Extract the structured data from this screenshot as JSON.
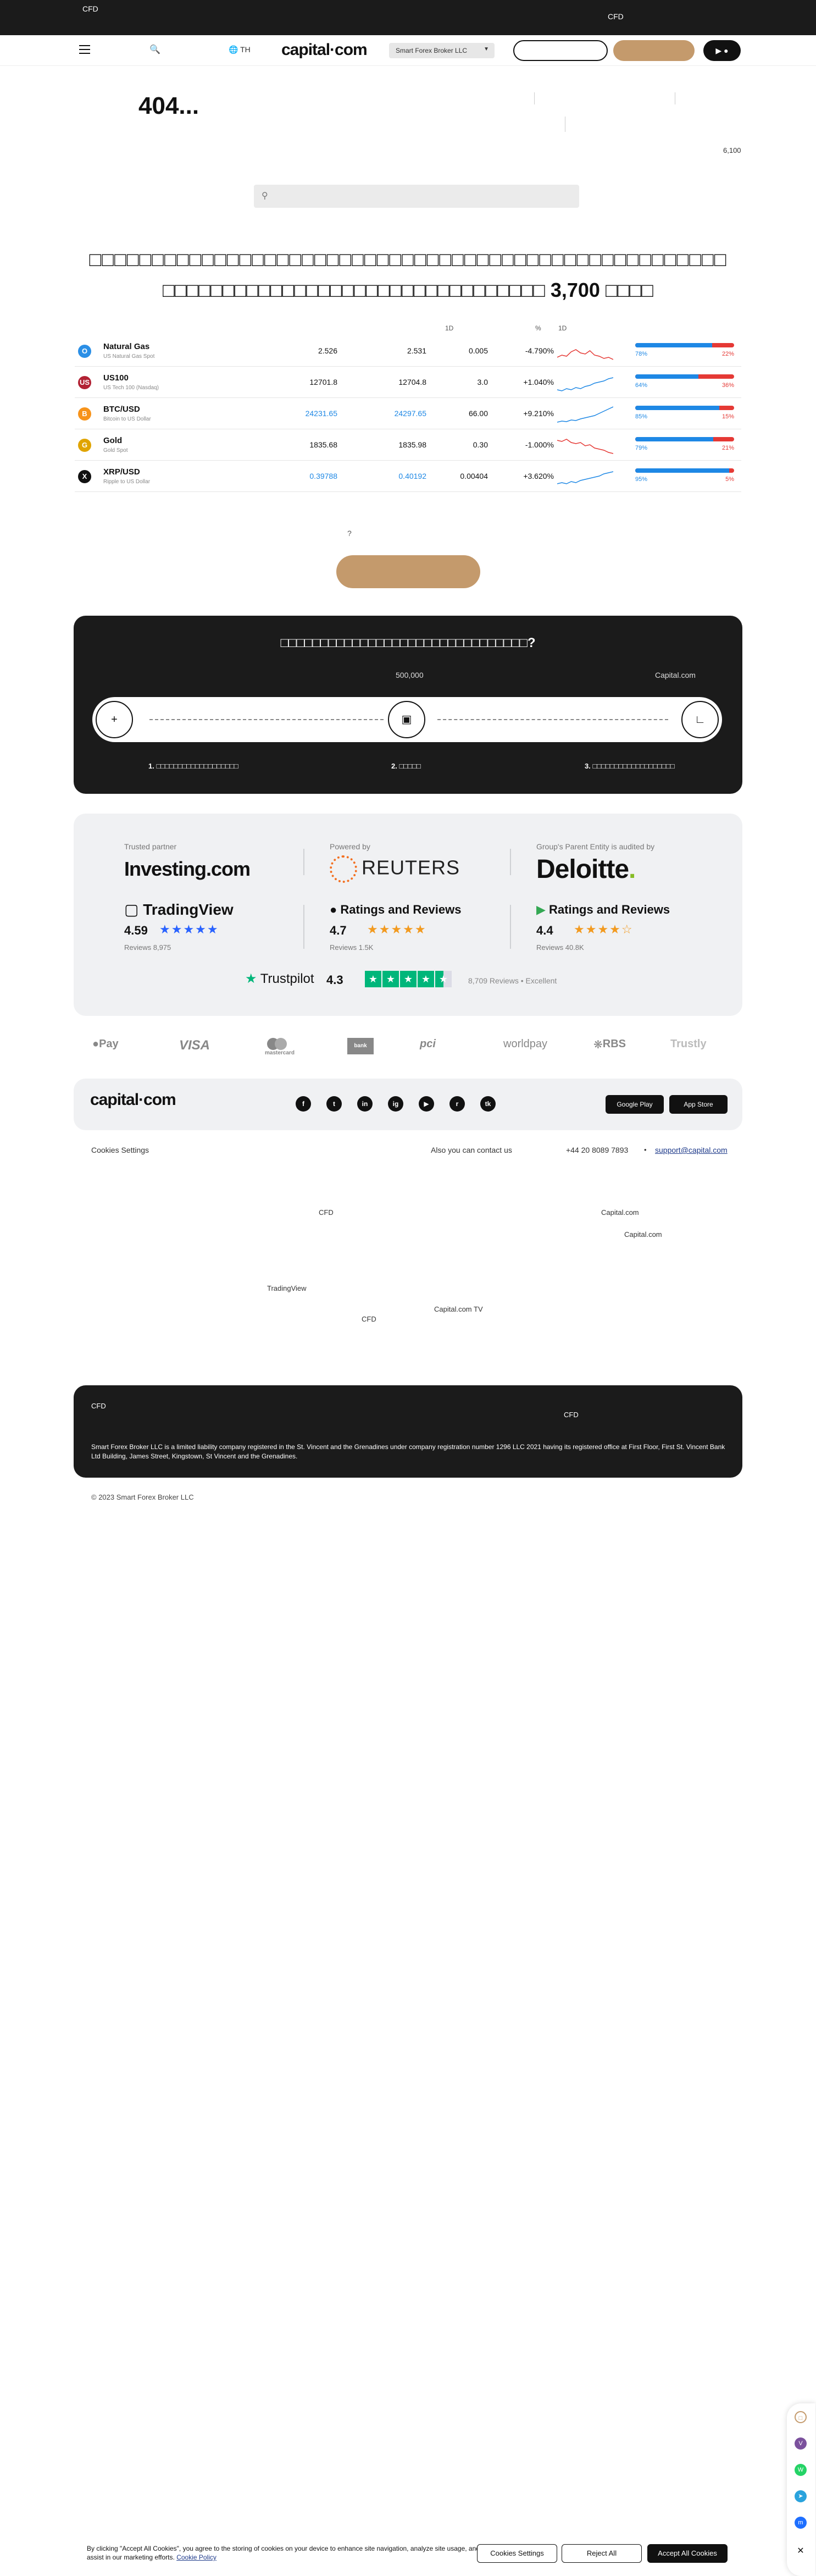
{
  "topbar": {
    "left_label": "CFD",
    "right_label": "CFD"
  },
  "header": {
    "lang": "TH",
    "logo": "capital·com",
    "broker": "Smart Forex Broker LLC",
    "play_icon": "▶"
  },
  "error": {
    "title": "404...",
    "small_number": "6,100"
  },
  "headline": {
    "line1": "□□□□□□□□□□□□□□□□□□□□□□□□□□□□□□□□□□□□□□□□□□□□□□□□□□□",
    "line2": "□□□□□□□□□□□□□□□□□□□□□□□□□□□□□□□□ 3,700 □□□□"
  },
  "market": {
    "headers": {
      "h1": "1D",
      "h2": "%",
      "h3": "1D"
    },
    "rows": [
      {
        "icon": "O",
        "icon_color": "#2b8fe6",
        "name": "Natural Gas",
        "sub": "US Natural Gas Spot",
        "sell": "2.526",
        "buy": "2.531",
        "spread": "0.005",
        "change": "-4.790%",
        "trend": "down",
        "buy_pct": 78,
        "buy_lbl": "78%",
        "sell_lbl": "22%",
        "spark": [
          28,
          24,
          26,
          18,
          14,
          20,
          22,
          16,
          24,
          26,
          30,
          28,
          32
        ]
      },
      {
        "icon": "US",
        "icon_color": "#b22234",
        "name": "US100",
        "sub": "US Tech 100 (Nasdaq)",
        "sell": "12701.8",
        "buy": "12704.8",
        "spread": "3.0",
        "change": "+1.040%",
        "trend": "up",
        "buy_pct": 64,
        "buy_lbl": "64%",
        "sell_lbl": "36%",
        "spark": [
          30,
          32,
          28,
          30,
          26,
          28,
          24,
          22,
          18,
          16,
          14,
          10,
          8
        ]
      },
      {
        "icon": "B",
        "icon_color": "#f7931a",
        "name": "BTC/USD",
        "sub": "Bitcoin to US Dollar",
        "sell": "24231.65",
        "buy": "24297.65",
        "spread": "66.00",
        "change": "+9.210%",
        "trend": "up",
        "buy_pct": 85,
        "buy_lbl": "85%",
        "sell_lbl": "15%",
        "spark": [
          32,
          30,
          31,
          28,
          29,
          26,
          24,
          22,
          20,
          16,
          12,
          8,
          4
        ]
      },
      {
        "icon": "G",
        "icon_color": "#e0a400",
        "name": "Gold",
        "sub": "Gold Spot",
        "sell": "1835.68",
        "buy": "1835.98",
        "spread": "0.30",
        "change": "-1.000%",
        "trend": "down",
        "buy_pct": 79,
        "buy_lbl": "79%",
        "sell_lbl": "21%",
        "spark": [
          8,
          10,
          6,
          12,
          14,
          12,
          18,
          16,
          22,
          24,
          26,
          30,
          32
        ]
      },
      {
        "icon": "X",
        "icon_color": "#111111",
        "name": "XRP/USD",
        "sub": "Ripple to US Dollar",
        "sell": "0.39788",
        "buy": "0.40192",
        "spread": "0.00404",
        "change": "+3.620%",
        "trend": "up",
        "buy_pct": 95,
        "buy_lbl": "95%",
        "sell_lbl": "5%",
        "spark": [
          30,
          28,
          30,
          26,
          28,
          24,
          22,
          20,
          18,
          16,
          12,
          10,
          8
        ]
      }
    ]
  },
  "cta": {
    "question": "?"
  },
  "steps": {
    "title": "□□□□□□□□□□□□□□□□□□□□□□□□□□□□□□□?",
    "label_a": "500,000",
    "label_b": "Capital.com",
    "step1": "1. □□□□□□□□□□□□□□□□□□□",
    "step2": "2. □□□□□",
    "step3": "3. □□□□□□□□□□□□□□□□□□□"
  },
  "trust": {
    "partner_lbl": "Trusted partner",
    "partner": "Investing.com",
    "powered_lbl": "Powered by",
    "powered": "REUTERS",
    "audited_lbl": "Group's Parent Entity is audited by",
    "audited": "Deloitte",
    "audited_dot": ".",
    "tv_name": "TradingView",
    "tv_score": "4.59",
    "tv_reviews": "Reviews 8,975",
    "apple_name": "Ratings and Reviews",
    "apple_score": "4.7",
    "apple_reviews": "Reviews 1.5K",
    "google_name": "Ratings and Reviews",
    "google_score": "4.4",
    "google_reviews": "Reviews 40.8K",
    "pilot_name": "Trustpilot",
    "pilot_score": "4.3",
    "pilot_reviews": "8,709 Reviews • Excellent"
  },
  "payments": [
    "Pay",
    "VISA",
    "mastercard",
    "bank",
    "pci",
    "worldpay",
    "RBS",
    "Trustly"
  ],
  "footer": {
    "logo": "capital·com",
    "socials": [
      "f",
      "t",
      "in",
      "ig",
      "▶",
      "r",
      "tk"
    ],
    "google_play": "Google Play",
    "app_store": "App Store",
    "cookies": "Cookies Settings",
    "contact": "Also you can contact us",
    "phone": "+44 20 8089 7893",
    "email": "support@capital.com",
    "bullet": "•"
  },
  "links": {
    "cfd1": "CFD",
    "cap1": "Capital.com",
    "cap2": "Capital.com",
    "tradingview": "TradingView",
    "cfd2": "CFD",
    "captv": "Capital.com TV"
  },
  "legal": {
    "cfd_a": "CFD",
    "cfd_b": "CFD",
    "text": "Smart Forex Broker LLC is a limited liability company registered in the St. Vincent and the Grenadines under company registration number 1296 LLC 2021 having its registered office at First Floor, First St. Vincent Bank Ltd Building, James Street, Kingstown, St Vincent and the Grenadines."
  },
  "copyright": "© 2023 Smart Forex Broker LLC",
  "cookie_banner": {
    "text": "By clicking \"Accept All Cookies\", you agree to the storing of cookies on your device to enhance site navigation, analyze site usage, and assist in our marketing efforts.",
    "policy": "Cookie Policy",
    "settings": "Cookies Settings",
    "reject": "Reject All",
    "accept": "Accept All Cookies"
  },
  "colors": {
    "accent": "#c49a6c",
    "dark": "#1b1b1b",
    "buy": "#1e88e5",
    "sell": "#e53935"
  }
}
